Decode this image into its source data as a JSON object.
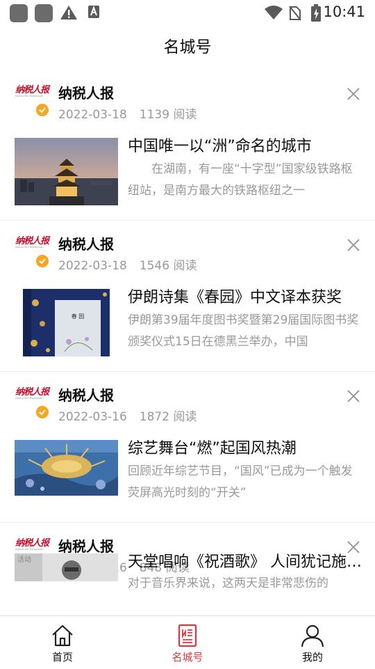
{
  "status_bar": {
    "time": "10:41"
  },
  "header": {
    "title": "名城号"
  },
  "feed": [
    {
      "logo_text": "纳税人报",
      "logo_subtext": "Nashui Ren Newspaper",
      "source": "纳税人报",
      "date": "2022-03-18",
      "reads": "1139 阅读",
      "title": "中国唯一以“洲”命名的城市",
      "summary": "在湖南，有一座“十字型”国家级铁路枢纽站，是南方最大的铁路枢纽之一",
      "indent": true
    },
    {
      "logo_text": "纳税人报",
      "logo_subtext": "Nashui Ren Newspaper",
      "source": "纳税人报",
      "date": "2022-03-18",
      "reads": "1546 阅读",
      "title": "伊朗诗集《春园》中文译本获奖",
      "summary": "伊朗第39届年度图书奖暨第29届国际图书奖颁奖仪式15日在德黑兰举办，中国",
      "indent": false
    },
    {
      "logo_text": "纳税人报",
      "logo_subtext": "Nashui Ren Newspaper",
      "source": "纳税人报",
      "date": "2022-03-16",
      "reads": "1872 阅读",
      "title": "综艺舞台“燃”起国风热潮",
      "summary": "回顾近年综艺节目，“国风”已成为一个触发荧屏高光时刻的“开关”",
      "indent": false
    },
    {
      "logo_text": "纳税人报",
      "logo_subtext": "Nashui Ren Newspaper",
      "source": "纳税人报",
      "date": "2022-03-16",
      "reads": "848 阅读",
      "title": "天堂唱响《祝酒歌》 人间犹记施光南",
      "summary": "对于音乐界来说，这两天是非常悲伤的",
      "indent": false
    }
  ],
  "thumb_labels": {
    "book_title": "春 园",
    "photo_caption": "活动"
  },
  "tab_bar": {
    "items": [
      {
        "label": "首页",
        "icon": "home-icon"
      },
      {
        "label": "名城号",
        "icon": "document-icon",
        "active": true
      },
      {
        "label": "我的",
        "icon": "person-icon"
      }
    ]
  },
  "colors": {
    "accent": "#e0383e",
    "verified": "#f5a623",
    "muted": "#999999"
  }
}
